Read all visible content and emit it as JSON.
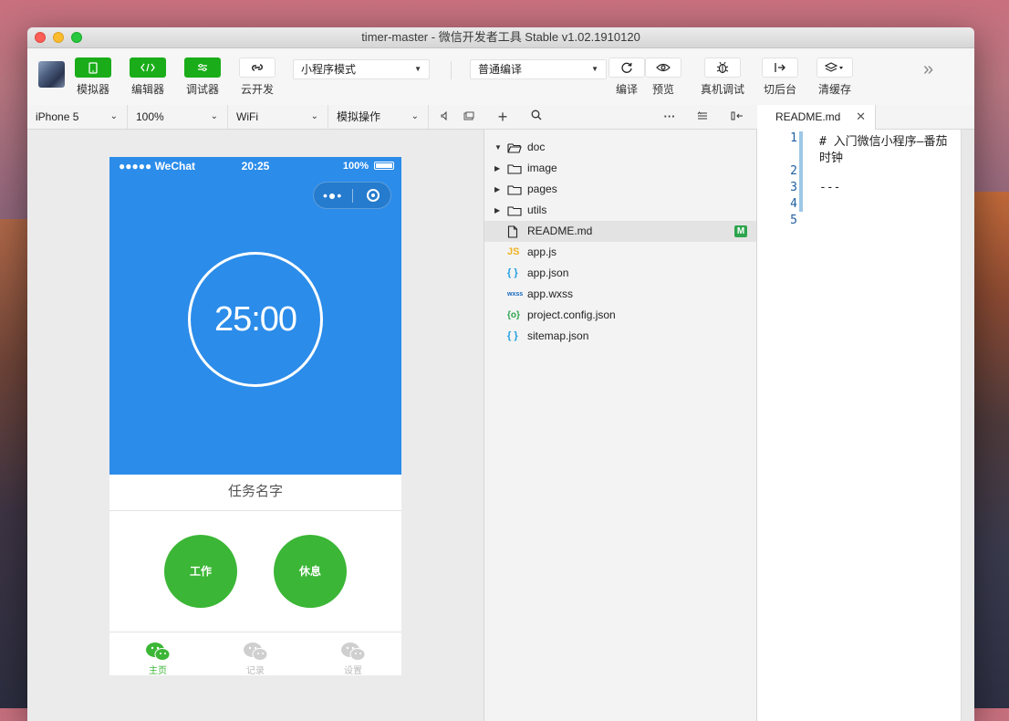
{
  "window": {
    "title": "timer-master - 微信开发者工具 Stable v1.02.1910120"
  },
  "toolbar": {
    "simulator": "模拟器",
    "editor": "编辑器",
    "debugger": "调试器",
    "cloud": "云开发",
    "mode_select": "小程序模式",
    "compile_select": "普通编译",
    "compile": "编译",
    "preview": "预览",
    "remote_debug": "真机调试",
    "background": "切后台",
    "clear_cache": "清缓存",
    "more": "»"
  },
  "subbar": {
    "device": "iPhone 5",
    "zoom": "100%",
    "network": "WiFi",
    "sim_ops": "模拟操作"
  },
  "phone": {
    "status_left": "●●●●● WeChat",
    "status_time": "20:25",
    "status_battery": "100%",
    "capsule_dots": "•●•",
    "timer": "25:00",
    "task_name": "任务名字",
    "work_button": "工作",
    "rest_button": "休息",
    "tabs": [
      "主页",
      "记录",
      "设置"
    ],
    "colors": {
      "header": "#2b8cea",
      "button": "#3bb636",
      "tab_active": "#3bb636",
      "tab_inactive": "#bbbbbb"
    }
  },
  "tree": {
    "items": [
      {
        "name": "doc",
        "type": "folder",
        "expanded": true,
        "icon": "folder-open-icon"
      },
      {
        "name": "image",
        "type": "folder",
        "expanded": false,
        "icon": "folder-icon"
      },
      {
        "name": "pages",
        "type": "folder",
        "expanded": false,
        "icon": "folder-icon"
      },
      {
        "name": "utils",
        "type": "folder",
        "expanded": false,
        "icon": "folder-icon"
      },
      {
        "name": "README.md",
        "type": "file",
        "icon": "file-icon",
        "badge": "M",
        "selected": true
      },
      {
        "name": "app.js",
        "type": "file",
        "icon": "js-icon",
        "icon_text": "JS"
      },
      {
        "name": "app.json",
        "type": "file",
        "icon": "json-icon",
        "icon_text": "{ }"
      },
      {
        "name": "app.wxss",
        "type": "file",
        "icon": "wxss-icon",
        "icon_text": "wxss"
      },
      {
        "name": "project.config.json",
        "type": "file",
        "icon": "config-icon",
        "icon_text": "{o}"
      },
      {
        "name": "sitemap.json",
        "type": "file",
        "icon": "json-icon",
        "icon_text": "{ }"
      }
    ]
  },
  "editor": {
    "tab_label": "README.md",
    "line_numbers": [
      "1",
      "2",
      "3",
      "4",
      "5"
    ],
    "lines": [
      "# 入门微信小程序—番茄",
      "时钟",
      "",
      "---",
      "",
      ""
    ]
  }
}
